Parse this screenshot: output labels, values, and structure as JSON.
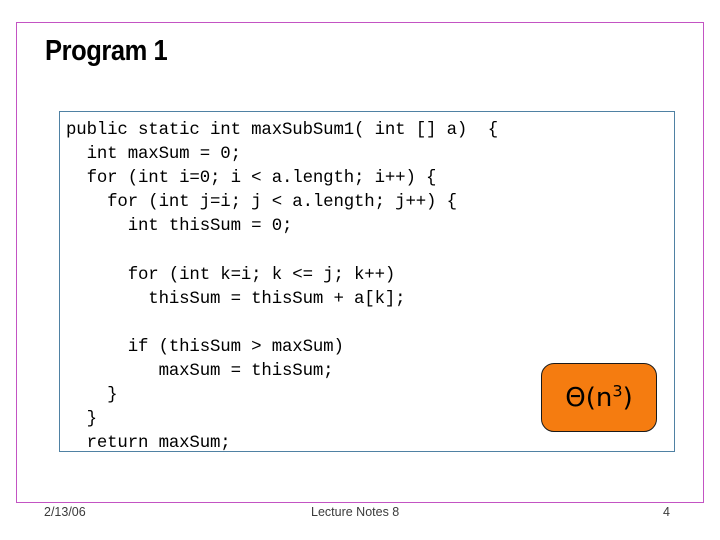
{
  "slide": {
    "title": "Program 1",
    "border_color": "#c354c3",
    "background": "#ffffff"
  },
  "code_box": {
    "border_color": "#4f81a3",
    "language": "java",
    "lines": [
      "public static int maxSubSum1( int [] a)  {",
      "  int maxSum = 0;",
      "  for (int i=0; i < a.length; i++) {",
      "    for (int j=i; j < a.length; j++) {",
      "      int thisSum = 0;",
      "",
      "      for (int k=i; k <= j; k++)",
      "        thisSum = thisSum + a[k];",
      "",
      "      if (thisSum > maxSum)",
      "         maxSum = thisSum;",
      "    }",
      "  }",
      "  return maxSum;",
      "}"
    ]
  },
  "badge": {
    "text": "Θ(n",
    "exponent": "3",
    "text_suffix": ")",
    "fill_color": "#f57c10",
    "border_color": "#1a1a1a"
  },
  "footer": {
    "date": "2/13/06",
    "title": "Lecture Notes 8",
    "page_number": "4"
  }
}
